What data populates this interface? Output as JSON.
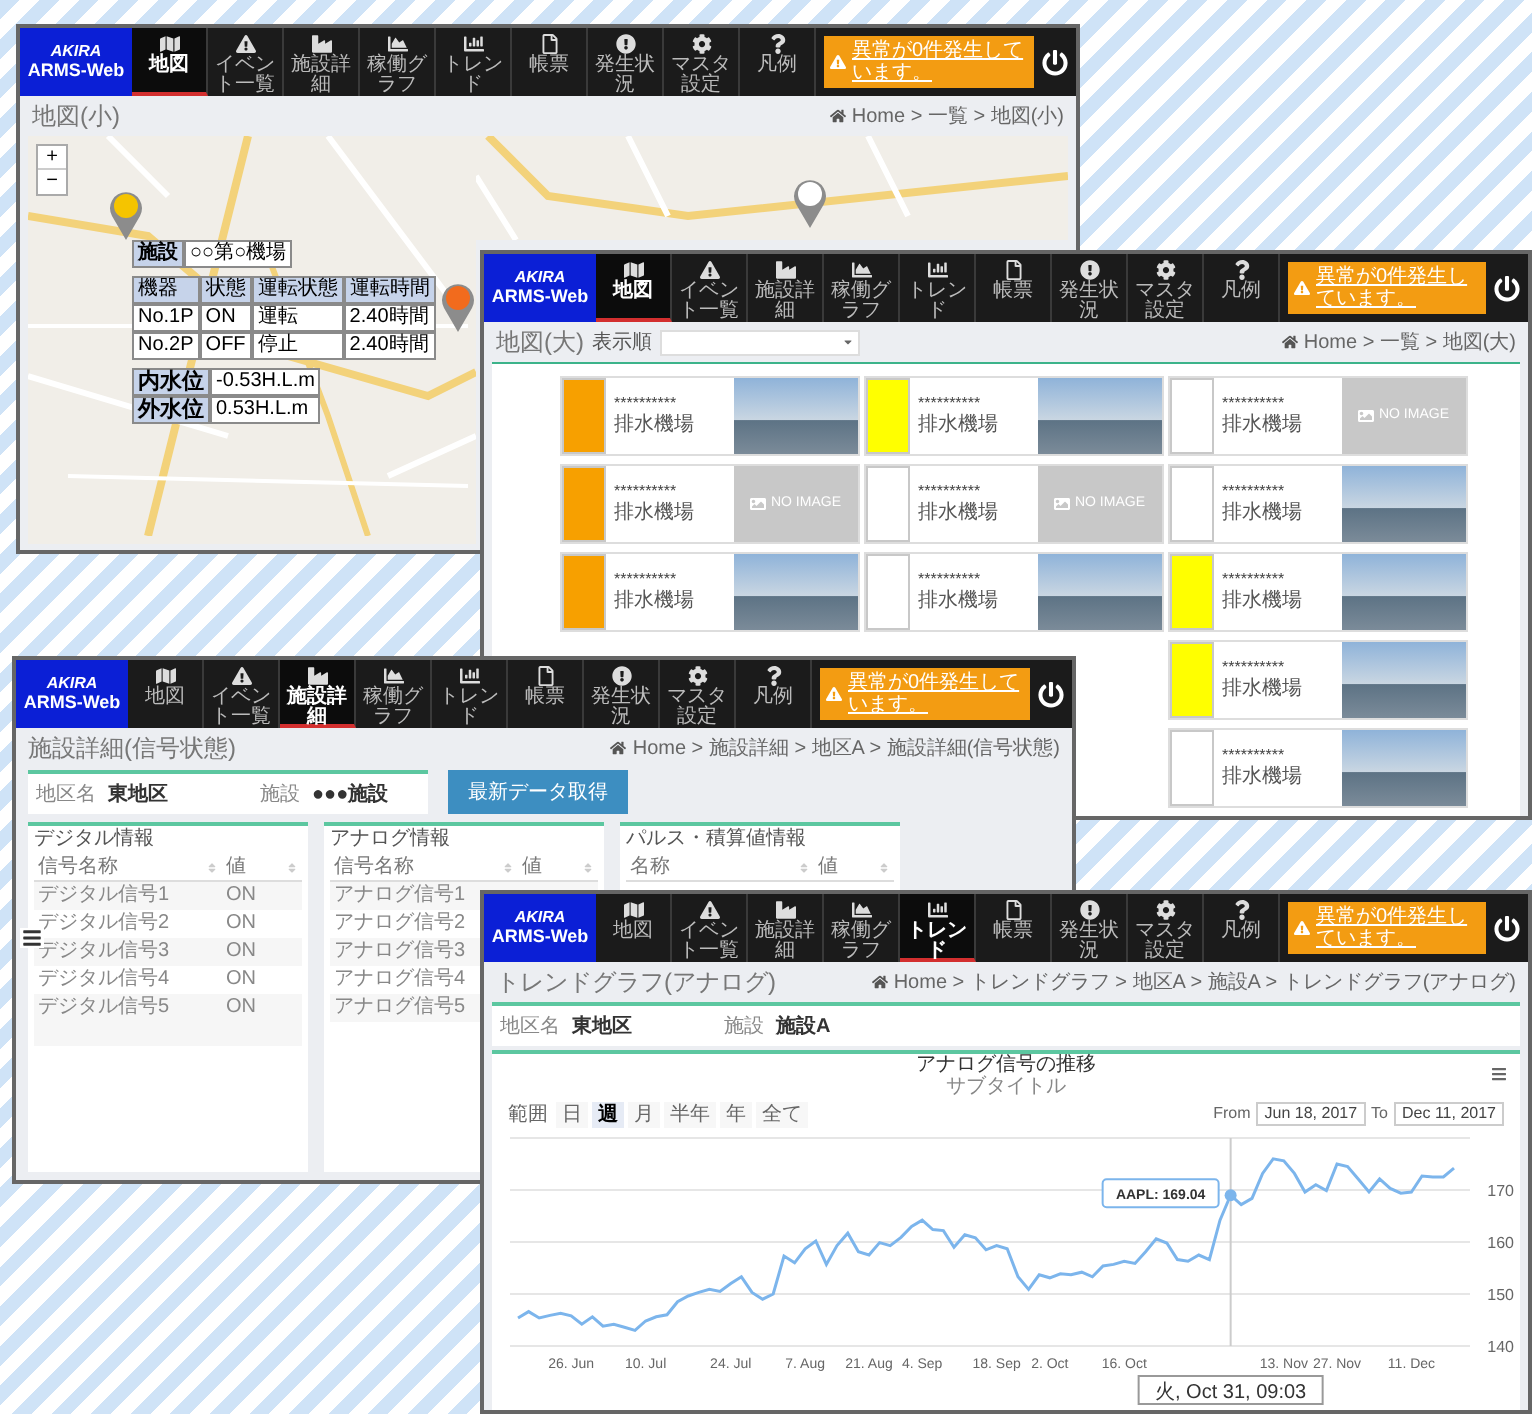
{
  "map_small": {
    "nav": {
      "brand": "AKIRA",
      "app": "ARMS-Web",
      "items": [
        {
          "label": "地図",
          "selected": true
        },
        {
          "label": "イベント一覧",
          "selected": false
        },
        {
          "label": "施設詳細",
          "selected": false
        },
        {
          "label": "稼働グラフ",
          "selected": false
        },
        {
          "label": "トレンド",
          "selected": false
        },
        {
          "label": "帳票",
          "selected": false
        },
        {
          "label": "発生状況",
          "selected": false
        },
        {
          "label": "マスタ設定",
          "selected": false
        },
        {
          "label": "凡例",
          "selected": false
        }
      ],
      "alert": "異常が0件発生しています。"
    },
    "title": "地図(小)",
    "breadcrumb": "Home > 一覧 > 地図(小)",
    "map": {
      "zoom_in": "+",
      "zoom_out": "−",
      "pins": [
        {
          "color": "#f5c400"
        },
        {
          "color": "#f26b1d"
        },
        {
          "color": "#ffffff"
        }
      ],
      "popup": {
        "facility_label": "施設",
        "facility": "○○第○機場",
        "columns": [
          "機器",
          "状態",
          "運転状態",
          "運転時間"
        ],
        "rows": [
          [
            "No.1P",
            "ON",
            "運転",
            "2.40時間"
          ],
          [
            "No.2P",
            "OFF",
            "停止",
            "2.40時間"
          ]
        ],
        "levels": [
          {
            "label": "内水位",
            "value": "-0.53H.L.m"
          },
          {
            "label": "外水位",
            "value": "0.53H.L.m"
          }
        ]
      }
    }
  },
  "map_large": {
    "nav": {
      "brand": "AKIRA",
      "app": "ARMS-Web",
      "items": [
        {
          "label": "地図",
          "selected": true
        },
        {
          "label": "イベント一覧",
          "selected": false
        },
        {
          "label": "施設詳細",
          "selected": false
        },
        {
          "label": "稼働グラフ",
          "selected": false
        },
        {
          "label": "トレンド",
          "selected": false
        },
        {
          "label": "帳票",
          "selected": false
        },
        {
          "label": "発生状況",
          "selected": false
        },
        {
          "label": "マスタ設定",
          "selected": false
        },
        {
          "label": "凡例",
          "selected": false
        }
      ],
      "alert": "異常が0件発生しています。"
    },
    "title": "地図(大)",
    "sort_label": "表示順",
    "breadcrumb": "Home > 一覧 > 地図(大)",
    "card_rows": [
      [
        {
          "color": "#f7a000",
          "code": "**********",
          "name": "排水機場",
          "kind": "photo"
        },
        {
          "color": "#ffff00",
          "code": "**********",
          "name": "排水機場",
          "kind": "photo"
        },
        {
          "color": "#ffffff",
          "code": "**********",
          "name": "排水機場",
          "kind": "no_image",
          "image_label": "NO IMAGE"
        }
      ],
      [
        {
          "color": "#f7a000",
          "code": "**********",
          "name": "排水機場",
          "kind": "no_image",
          "image_label": "NO IMAGE"
        },
        {
          "color": "#ffffff",
          "code": "**********",
          "name": "排水機場",
          "kind": "no_image",
          "image_label": "NO IMAGE"
        },
        {
          "color": "#ffffff",
          "code": "**********",
          "name": "排水機場",
          "kind": "photo"
        }
      ],
      [
        {
          "color": "#f7a000",
          "code": "**********",
          "name": "排水機場",
          "kind": "photo"
        },
        {
          "color": "#ffffff",
          "code": "**********",
          "name": "排水機場",
          "kind": "photo"
        },
        {
          "color": "#ffff00",
          "code": "**********",
          "name": "排水機場",
          "kind": "photo"
        }
      ],
      [
        null,
        null,
        {
          "color": "#ffff00",
          "code": "**********",
          "name": "排水機場",
          "kind": "photo"
        }
      ],
      [
        null,
        null,
        {
          "color": "#ffffff",
          "code": "**********",
          "name": "排水機場",
          "kind": "photo"
        }
      ]
    ]
  },
  "facility_detail": {
    "nav": {
      "brand": "AKIRA",
      "app": "ARMS-Web",
      "items": [
        {
          "label": "地図",
          "selected": false
        },
        {
          "label": "イベント一覧",
          "selected": false
        },
        {
          "label": "施設詳細",
          "selected": true
        },
        {
          "label": "稼働グラフ",
          "selected": false
        },
        {
          "label": "トレンド",
          "selected": false
        },
        {
          "label": "帳票",
          "selected": false
        },
        {
          "label": "発生状況",
          "selected": false
        },
        {
          "label": "マスタ設定",
          "selected": false
        },
        {
          "label": "凡例",
          "selected": false
        }
      ],
      "alert": "異常が0件発生しています。"
    },
    "title": "施設詳細(信号状態)",
    "breadcrumb": "Home > 施設詳細 > 地区A > 施設詳細(信号状態)",
    "info": [
      {
        "label": "地区名",
        "value": "東地区"
      },
      {
        "label": "施設",
        "value": "●●●施設"
      }
    ],
    "refresh_button": "最新データ取得",
    "panels": [
      {
        "title": "デジタル情報",
        "columns": [
          "信号名称",
          "値"
        ],
        "rows": [
          [
            "デジタル信号1",
            "ON"
          ],
          [
            "デジタル信号2",
            "ON"
          ],
          [
            "デジタル信号3",
            "ON"
          ],
          [
            "デジタル信号4",
            "ON"
          ],
          [
            "デジタル信号5",
            "ON"
          ]
        ]
      },
      {
        "title": "アナログ情報",
        "columns": [
          "信号名称",
          "値"
        ],
        "rows": [
          [
            "アナログ信号1"
          ],
          [
            "アナログ信号2"
          ],
          [
            "アナログ信号3"
          ],
          [
            "アナログ信号4"
          ],
          [
            "アナログ信号5"
          ]
        ]
      },
      {
        "title": "パルス・積算値情報",
        "columns": [
          "名称",
          "値"
        ]
      }
    ]
  },
  "trend": {
    "nav": {
      "brand": "AKIRA",
      "app": "ARMS-Web",
      "items": [
        {
          "label": "地図",
          "selected": false
        },
        {
          "label": "イベント一覧",
          "selected": false
        },
        {
          "label": "施設詳細",
          "selected": false
        },
        {
          "label": "稼働グラフ",
          "selected": false
        },
        {
          "label": "トレンド",
          "selected": true
        },
        {
          "label": "帳票",
          "selected": false
        },
        {
          "label": "発生状況",
          "selected": false
        },
        {
          "label": "マスタ設定",
          "selected": false
        },
        {
          "label": "凡例",
          "selected": false
        }
      ],
      "alert": "異常が0件発生しています。"
    },
    "title": "トレンドグラフ(アナログ)",
    "breadcrumb": "Home > トレンドグラフ > 地区A > 施設A > トレンドグラフ(アナログ)",
    "info": [
      {
        "label": "地区名",
        "value": "東地区"
      },
      {
        "label": "施設",
        "value": "施設A"
      }
    ],
    "chart_subtitle": "サブタイトル",
    "range_label": "範囲",
    "ranges": [
      {
        "label": "日",
        "selected": false
      },
      {
        "label": "週",
        "selected": true
      },
      {
        "label": "月",
        "selected": false
      },
      {
        "label": "半年",
        "selected": false
      },
      {
        "label": "年",
        "selected": false
      },
      {
        "label": "全て",
        "selected": false
      }
    ],
    "from_label": "From",
    "from": "Jun 18, 2017",
    "to_label": "To",
    "to": "Dec 11, 2017",
    "chart_data": {
      "type": "line",
      "title": "アナログ信号の推移",
      "categories": [
        null,
        null,
        null,
        null,
        null,
        "26. Jun",
        null,
        null,
        null,
        null,
        null,
        null,
        "10. Jul",
        null,
        null,
        null,
        null,
        null,
        null,
        null,
        "24. Jul",
        null,
        null,
        null,
        null,
        null,
        null,
        "7. Aug",
        null,
        null,
        null,
        null,
        null,
        "21. Aug",
        null,
        null,
        null,
        null,
        "4. Sep",
        null,
        null,
        null,
        null,
        null,
        null,
        "18. Sep",
        null,
        null,
        null,
        null,
        "2. Oct",
        null,
        null,
        null,
        null,
        null,
        null,
        "16. Oct",
        null,
        null,
        null,
        null,
        null,
        null,
        null,
        null,
        null,
        null,
        null,
        null,
        null,
        null,
        "13. Nov",
        null,
        null,
        null,
        null,
        "27. Nov",
        null,
        null,
        null,
        null,
        null,
        null,
        "11. Dec",
        null,
        null,
        null,
        null
      ],
      "series": [
        {
          "name": "AAPL",
          "color": "#7cb5ec",
          "values": [
            145.4,
            146.6,
            145.4,
            145.9,
            146.3,
            145.8,
            144.2,
            145.6,
            143.8,
            144.2,
            143.6,
            143,
            144.8,
            145.6,
            146,
            148.5,
            149.6,
            150.3,
            150.9,
            150.5,
            152,
            153.3,
            150.3,
            149,
            150,
            157.3,
            156,
            158.7,
            160.2,
            155.7,
            159.3,
            161.7,
            158.1,
            157.5,
            159.9,
            159.3,
            160.9,
            163,
            164.2,
            162.4,
            162.2,
            159,
            161.4,
            160.8,
            158.5,
            159.3,
            158.7,
            153.3,
            150.9,
            153.7,
            153.1,
            153.9,
            153.7,
            154.2,
            153.3,
            155.4,
            155.7,
            156.3,
            155.9,
            158.1,
            160.6,
            159.8,
            156.6,
            156.3,
            157.5,
            156.6,
            164.2,
            169,
            167.2,
            168.4,
            173.2,
            176,
            175.6,
            173.2,
            169.6,
            171,
            169.9,
            175,
            174.5,
            172.1,
            169.6,
            172.1,
            170.3,
            169.4,
            169.6,
            172.7,
            172.5,
            172.5,
            174.2
          ]
        }
      ],
      "ylim": [
        140,
        180
      ],
      "yticks": [
        140,
        150,
        160,
        170
      ],
      "grid": true,
      "annotations": [
        ": 169.04",
        "火, Oct 31, 09:03"
      ]
    }
  }
}
